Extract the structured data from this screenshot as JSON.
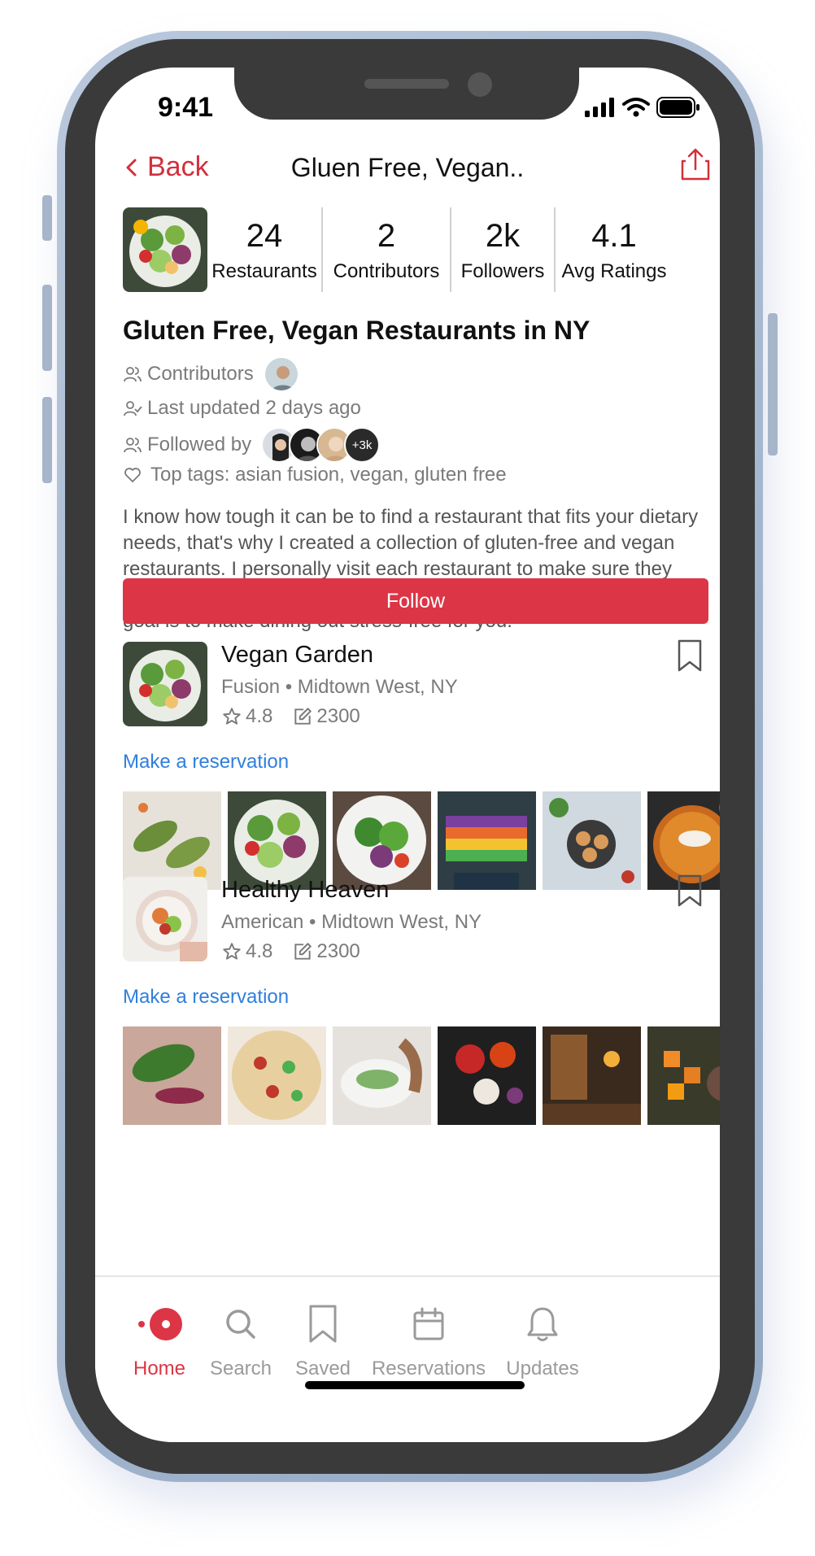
{
  "status_bar": {
    "time": "9:41"
  },
  "nav": {
    "back_label": "Back",
    "title": "Gluen Free, Vegan.."
  },
  "stats": [
    {
      "value": "24",
      "label": "Restaurants"
    },
    {
      "value": "2",
      "label": "Contributors"
    },
    {
      "value": "2k",
      "label": "Followers"
    },
    {
      "value": "4.1",
      "label": "Avg Ratings"
    }
  ],
  "collection": {
    "title": "Gluten Free, Vegan Restaurants in NY",
    "contributors_label": "Contributors",
    "last_updated": "Last updated 2 days ago",
    "followed_by_label": "Followed by",
    "followers_more": "+3k",
    "top_tags": "Top tags: asian fusion, vegan, gluten free",
    "description": "I know how tough it can be to find a restaurant that fits your dietary needs, that's why I created a collection of gluten-free and vegan restaurants. I personally visit each restaurant to make sure they have options for you and I keep the collection updated for you. My goal is to make dining out stress-free for you.",
    "follow_label": "Follow"
  },
  "restaurants": [
    {
      "name": "Vegan Garden",
      "subtitle": "Fusion • Midtown West, NY",
      "rating": "4.8",
      "reviews": "2300",
      "reserve_label": "Make a reservation"
    },
    {
      "name": "Healthy Heaven",
      "subtitle": "American • Midtown West, NY",
      "rating": "4.8",
      "reviews": "2300",
      "reserve_label": "Make a reservation"
    }
  ],
  "tabs": [
    {
      "label": "Home",
      "icon": "home-dot-icon",
      "active": true
    },
    {
      "label": "Search",
      "icon": "search-icon",
      "active": false
    },
    {
      "label": "Saved",
      "icon": "bookmark-icon",
      "active": false
    },
    {
      "label": "Reservations",
      "icon": "calendar-icon",
      "active": false
    },
    {
      "label": "Updates",
      "icon": "bell-icon",
      "active": false
    }
  ],
  "colors": {
    "accent": "#dc3545",
    "link": "#2f7fdc",
    "muted": "#7a7a7a"
  }
}
